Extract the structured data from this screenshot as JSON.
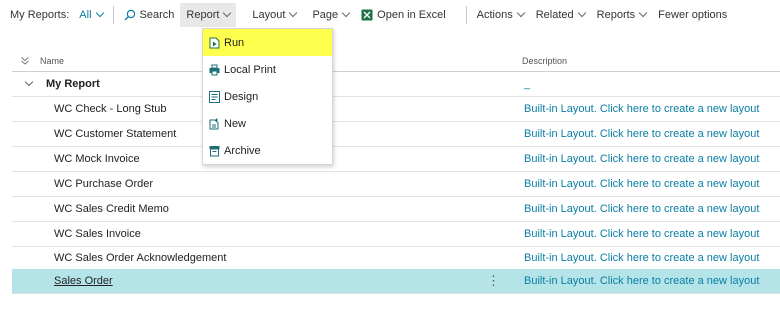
{
  "toolbar": {
    "title": "My Reports:",
    "filter": "All",
    "search": "Search",
    "report": "Report",
    "layout": "Layout",
    "page": "Page",
    "open_excel": "Open in Excel",
    "actions": "Actions",
    "related": "Related",
    "reports": "Reports",
    "fewer_options": "Fewer options"
  },
  "table": {
    "col_name": "Name",
    "col_desc": "Description",
    "group": {
      "name": "My Report",
      "desc": "_"
    },
    "rows": [
      {
        "name": "WC Check - Long Stub",
        "desc": "Built-in Layout. Click here to create a new layout"
      },
      {
        "name": "WC Customer Statement",
        "desc": "Built-in Layout. Click here to create a new layout"
      },
      {
        "name": "WC Mock Invoice",
        "desc": "Built-in Layout. Click here to create a new layout"
      },
      {
        "name": "WC Purchase Order",
        "desc": "Built-in Layout. Click here to create a new layout"
      },
      {
        "name": "WC Sales Credit Memo",
        "desc": "Built-in Layout. Click here to create a new layout"
      },
      {
        "name": "WC Sales Invoice",
        "desc": "Built-in Layout. Click here to create a new layout"
      },
      {
        "name": "WC Sales Order Acknowledgement",
        "desc": "Built-in Layout. Click here to create a new layout"
      },
      {
        "name": "Sales Order",
        "desc": "Built-in Layout. Click here to create a new layout"
      }
    ]
  },
  "dropdown": {
    "items": [
      {
        "label": "Run",
        "icon": "run-icon"
      },
      {
        "label": "Local Print",
        "icon": "printer-icon"
      },
      {
        "label": "Design",
        "icon": "design-icon"
      },
      {
        "label": "New",
        "icon": "new-icon"
      },
      {
        "label": "Archive",
        "icon": "archive-icon"
      }
    ]
  },
  "colors": {
    "accent": "#0a7ea4",
    "selected_row": "#b4e4e8",
    "highlight": "#ffff4d",
    "excel": "#1e7145"
  }
}
